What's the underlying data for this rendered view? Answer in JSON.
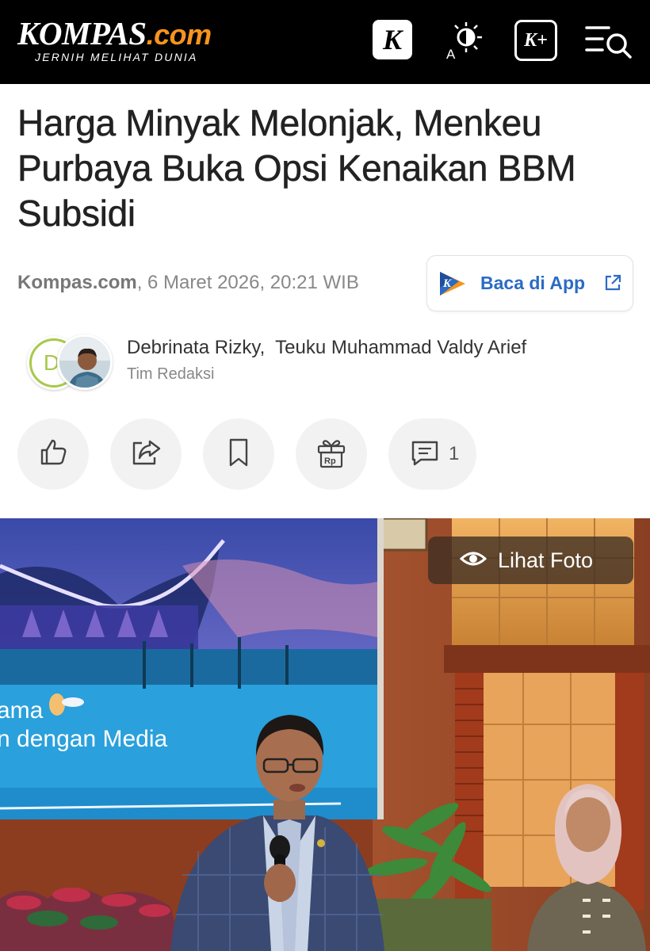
{
  "header": {
    "logo_main": "KOMPAS",
    "logo_domain": ".com",
    "logo_tagline": "JERNIH MELIHAT DUNIA",
    "k_button": "K",
    "kplus_button": "K+",
    "icons": [
      "kompas-k-icon",
      "theme-contrast-icon",
      "kompas-plus-icon",
      "menu-search-icon"
    ],
    "colors": {
      "background": "#000000",
      "accent": "#f7941d"
    }
  },
  "article": {
    "title": "Harga Minyak Melonjak, Menkeu Purbaya Buka Opsi Kenaikan BBM Subsidi",
    "source": "Kompas.com",
    "date": ", 6 Maret 2026, 20:21 WIB",
    "app_button": "Baca di App",
    "authors": "Debrinata Rizky,  Teuku Muhammad Valdy Arief",
    "team": "Tim Redaksi",
    "avatar_initial": "D",
    "link_color": "#2b6bc4"
  },
  "actions": {
    "comment_count": "1",
    "icons": [
      "like-icon",
      "share-icon",
      "bookmark-icon",
      "gift-rp-icon",
      "comment-icon"
    ]
  },
  "photo": {
    "view_label": "Lihat Foto",
    "screen_text_1": "ama",
    "screen_text_2": "n dengan Media"
  }
}
